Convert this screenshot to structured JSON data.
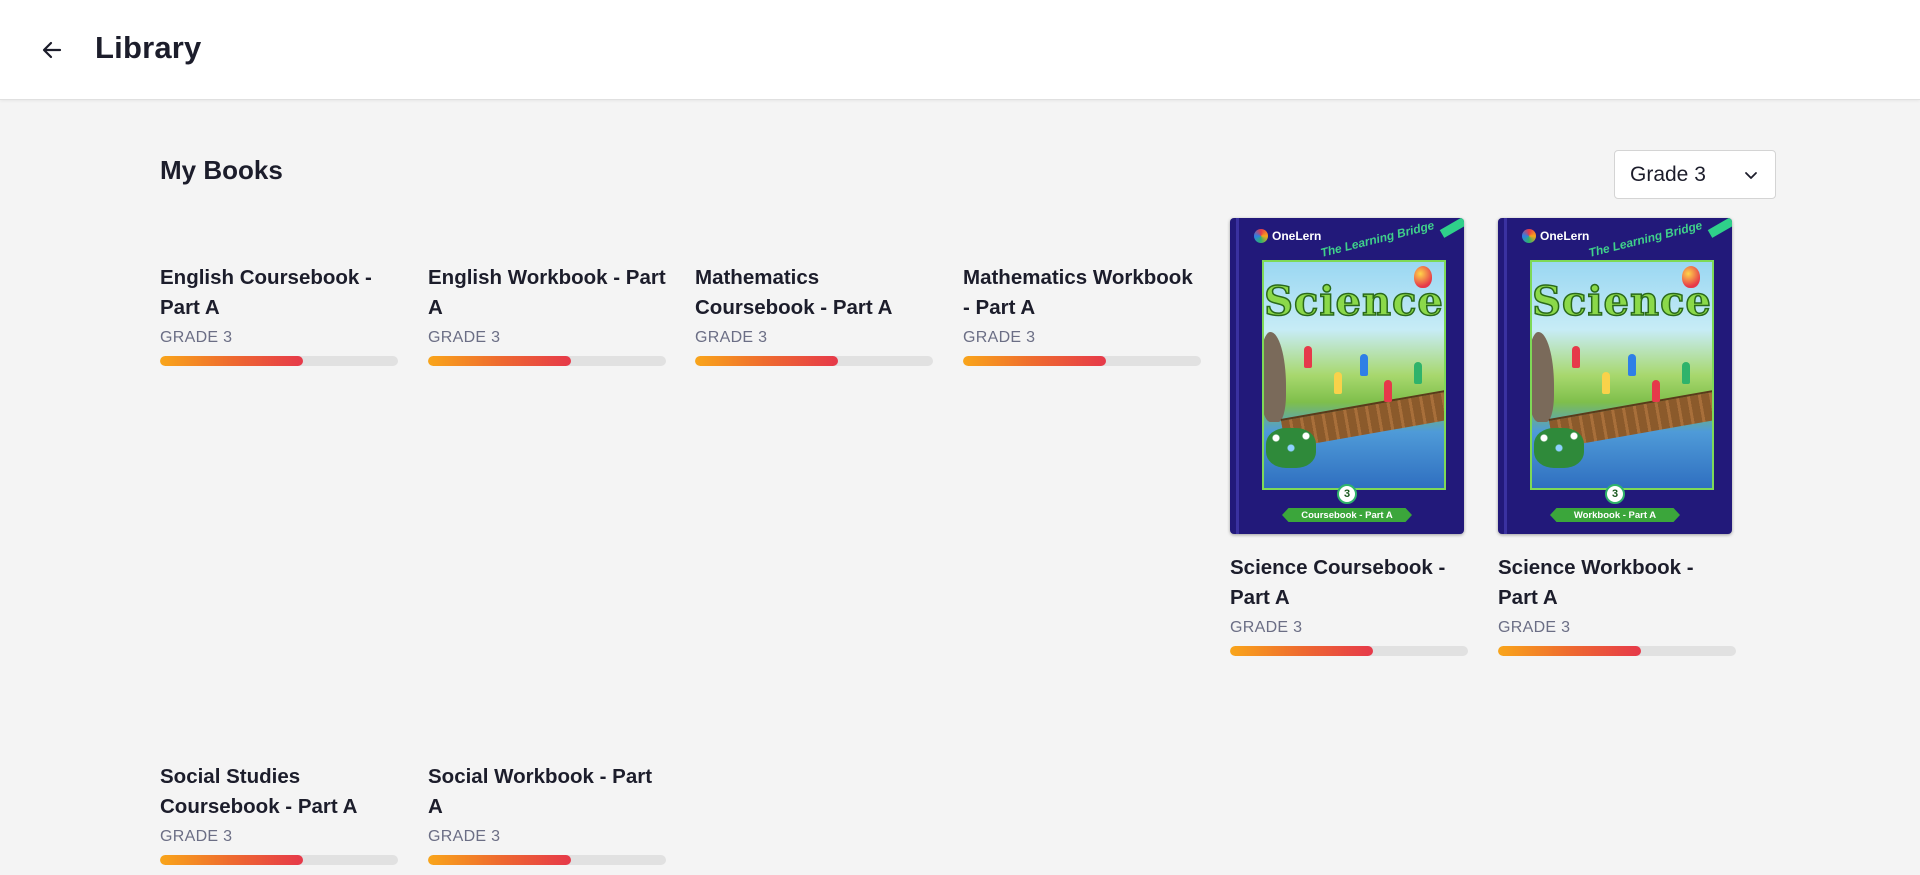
{
  "header": {
    "title": "Library",
    "back_icon": "arrow-left-icon"
  },
  "main": {
    "section_title": "My Books",
    "grade_filter": {
      "selected": "Grade 3",
      "icon": "chevron-down-icon"
    }
  },
  "books": [
    {
      "title": "English Coursebook - Part A",
      "grade": "GRADE 3",
      "progress": 0.6
    },
    {
      "title": "English Workbook - Part A",
      "grade": "GRADE 3",
      "progress": 0.6
    },
    {
      "title": "Mathematics Coursebook - Part A",
      "grade": "GRADE 3",
      "progress": 0.6
    },
    {
      "title": "Mathematics Workbook - Part A",
      "grade": "GRADE 3",
      "progress": 0.6
    },
    {
      "title": "Science Coursebook - Part A",
      "grade": "GRADE 3",
      "progress": 0.6,
      "cover": {
        "brand": "OneLern",
        "tagline": "The Learning Bridge",
        "subject": "Science",
        "number": "3",
        "band": "Coursebook - Part A",
        "bg": "#22197a"
      }
    },
    {
      "title": "Science Workbook - Part A",
      "grade": "GRADE 3",
      "progress": 0.6,
      "cover": {
        "brand": "OneLern",
        "tagline": "The Learning Bridge",
        "subject": "Science",
        "number": "3",
        "band": "Workbook - Part A",
        "bg": "#22197a"
      }
    },
    {
      "title": "Social Studies Coursebook - Part A",
      "grade": "GRADE 3",
      "progress": 0.6
    },
    {
      "title": "Social Workbook - Part A",
      "grade": "GRADE 3",
      "progress": 0.6
    }
  ],
  "colors": {
    "progress_start": "#f9a51a",
    "progress_end": "#e6394a",
    "accent_green": "#2fd08a"
  }
}
